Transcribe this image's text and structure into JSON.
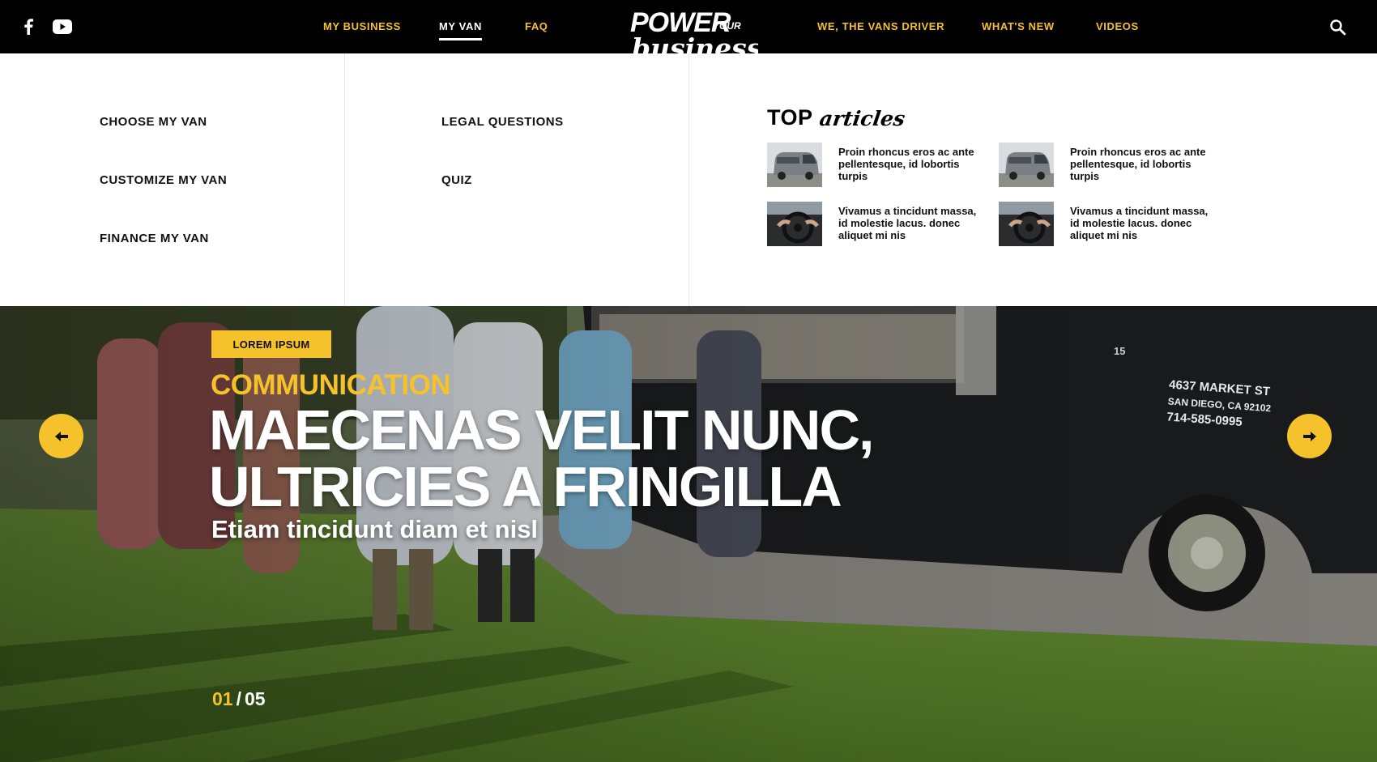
{
  "nav": {
    "social": [
      "facebook-icon",
      "youtube-icon"
    ],
    "left_items": [
      "MY BUSINESS",
      "MY VAN",
      "FAQ"
    ],
    "right_items": [
      "WE, THE VANS DRIVER",
      "WHAT'S NEW",
      "VIDEOS"
    ],
    "active": "MY VAN",
    "logo": {
      "line1": "POWER",
      "small": "YOUR",
      "line2": "business"
    },
    "search_icon": "search-icon"
  },
  "dropdown": {
    "column1": [
      "CHOOSE MY VAN",
      "CUSTOMIZE MY VAN",
      "FINANCE MY VAN"
    ],
    "column2": [
      "LEGAL QUESTIONS",
      "QUIZ"
    ],
    "top_articles": {
      "title_bold": "TOP",
      "title_script": "articles",
      "items": [
        {
          "text": "Proin rhoncus eros ac ante pellentesque, id lobortis turpis",
          "thumb": "van"
        },
        {
          "text": "Proin rhoncus eros ac ante pellentesque, id lobortis turpis",
          "thumb": "van"
        },
        {
          "text": "Vivamus a tincidunt massa, id molestie lacus. donec aliquet mi nis",
          "thumb": "steering-wheel"
        },
        {
          "text": "Vivamus a tincidunt massa, id molestie lacus. donec aliquet mi nis",
          "thumb": "steering-wheel"
        }
      ]
    }
  },
  "hero": {
    "tag": "LOREM IPSUM",
    "category": "COMMUNICATION",
    "headline_line1": "MAECENAS VELIT NUNC,",
    "headline_line2": "ULTRICIES A FRINGILLA",
    "subhead": "Etiam tincidunt diam et nisl",
    "truck_text": [
      "4637 MARKET ST",
      "SAN DIEGO, CA 92102",
      "714-585-0995"
    ],
    "truck_number": "15",
    "pager_current": "01",
    "pager_total": "05",
    "prev_icon": "arrow-left-icon",
    "next_icon": "arrow-right-icon"
  },
  "colors": {
    "accent": "#f5c22c",
    "nav_bg": "#000000",
    "text": "#111111"
  }
}
